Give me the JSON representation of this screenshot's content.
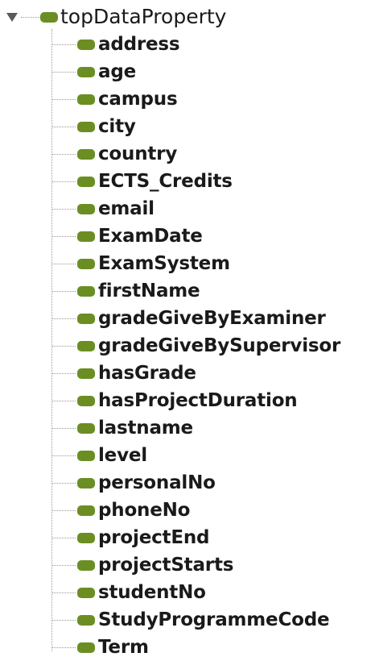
{
  "tree": {
    "root": {
      "label": "topDataProperty",
      "icon": "data-property-icon",
      "icon_color": "#6b8e23",
      "expanded": true
    },
    "children": [
      {
        "label": "address"
      },
      {
        "label": "age"
      },
      {
        "label": "campus"
      },
      {
        "label": "city"
      },
      {
        "label": "country"
      },
      {
        "label": "ECTS_Credits"
      },
      {
        "label": "email"
      },
      {
        "label": "ExamDate"
      },
      {
        "label": "ExamSystem"
      },
      {
        "label": "firstName"
      },
      {
        "label": "gradeGiveByExaminer"
      },
      {
        "label": "gradeGiveBySupervisor"
      },
      {
        "label": "hasGrade"
      },
      {
        "label": "hasProjectDuration"
      },
      {
        "label": "lastname"
      },
      {
        "label": "level"
      },
      {
        "label": "personalNo"
      },
      {
        "label": "phoneNo"
      },
      {
        "label": "projectEnd"
      },
      {
        "label": "projectStarts"
      },
      {
        "label": "studentNo"
      },
      {
        "label": "StudyProgrammeCode"
      },
      {
        "label": "Term"
      }
    ]
  }
}
